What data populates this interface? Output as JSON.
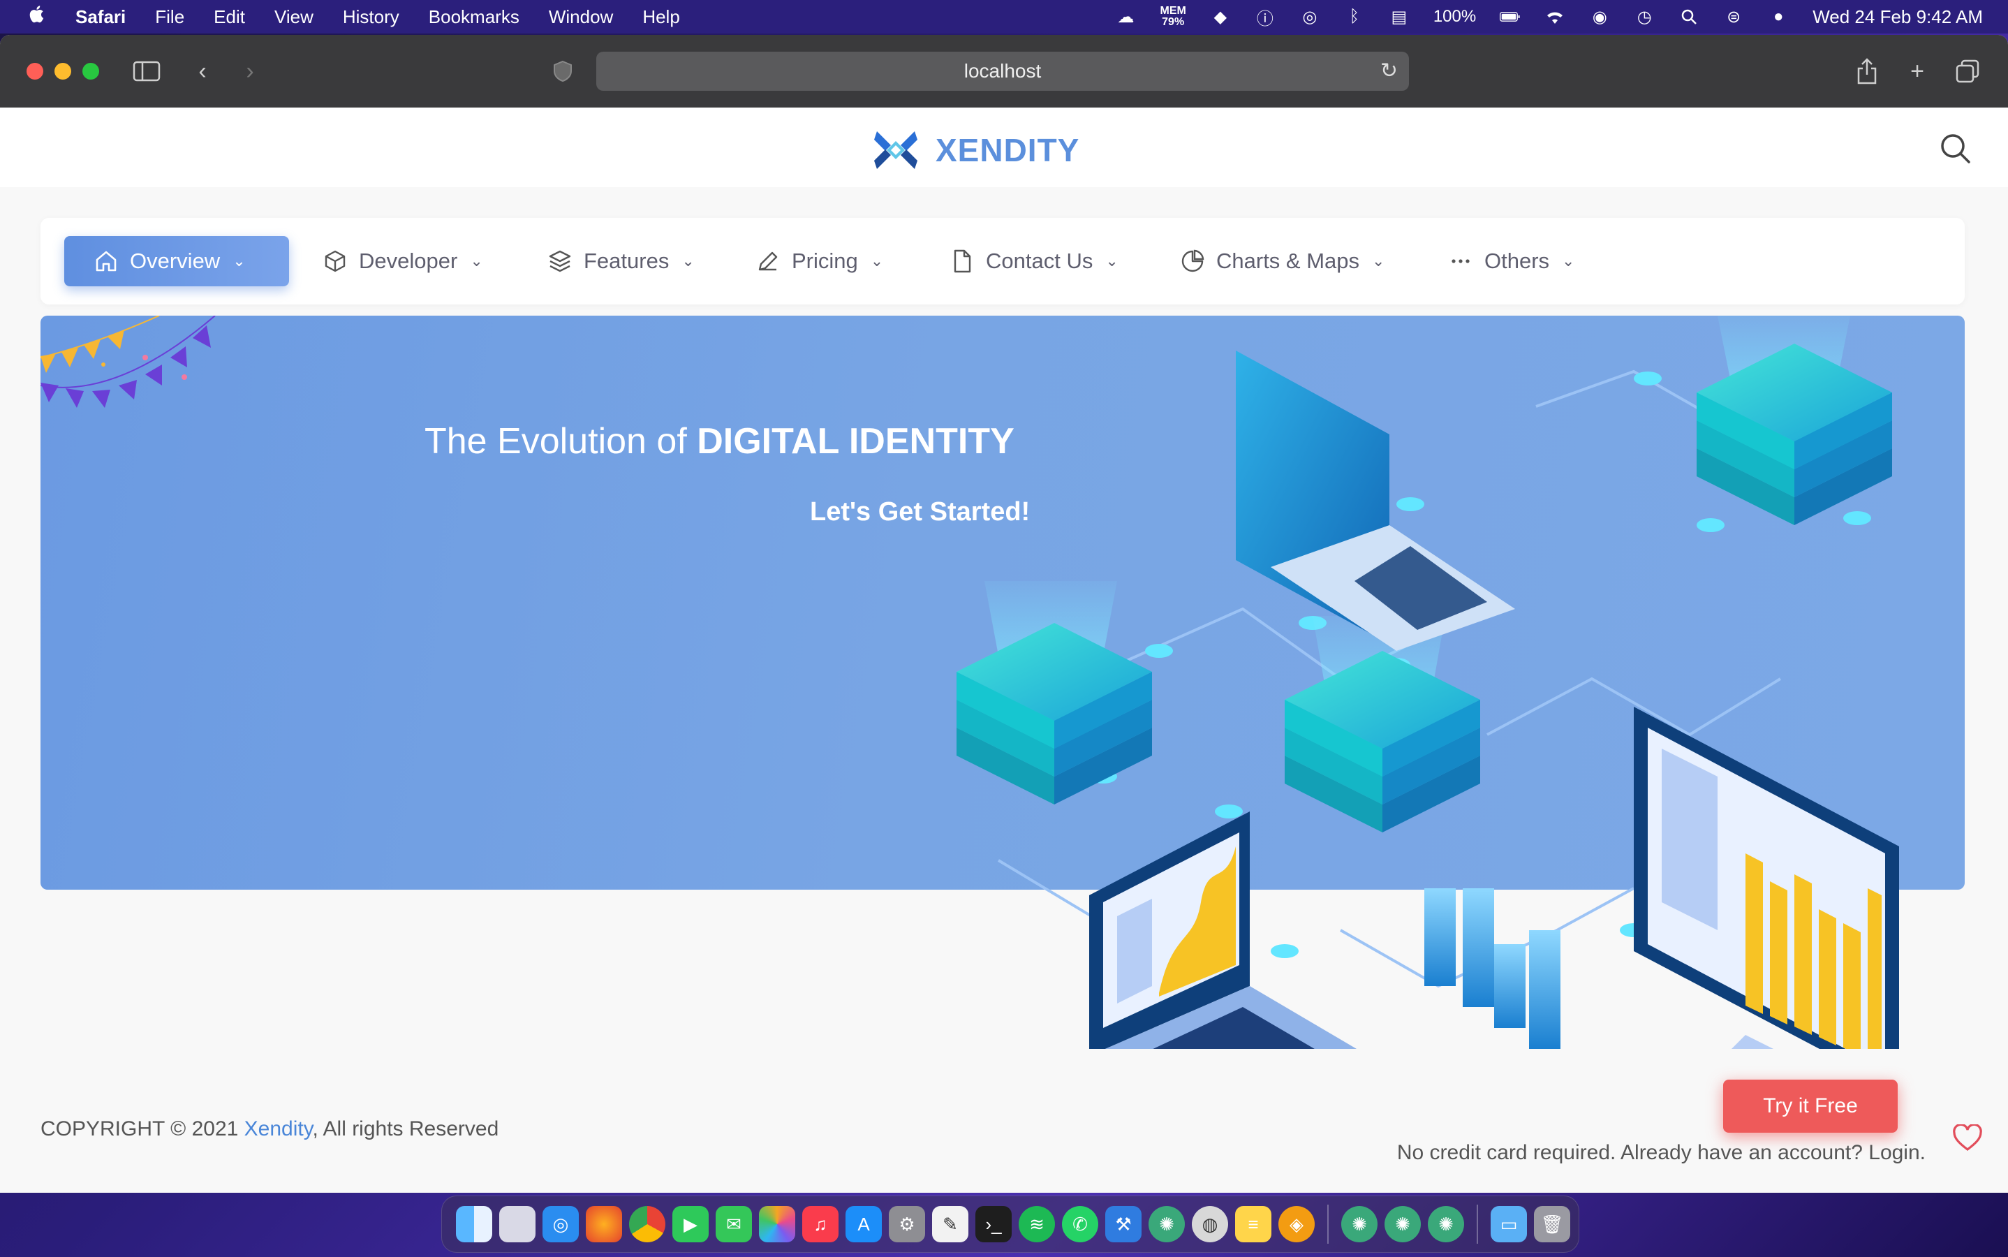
{
  "menubar": {
    "app_name": "Safari",
    "menus": [
      "File",
      "Edit",
      "View",
      "History",
      "Bookmarks",
      "Window",
      "Help"
    ],
    "mem_label": "MEM",
    "mem_value": "79%",
    "battery": "100%",
    "datetime": "Wed 24 Feb  9:42 AM"
  },
  "browser": {
    "url": "localhost"
  },
  "site": {
    "brand": "XENDITY",
    "nav": [
      {
        "label": "Overview",
        "icon": "home-icon",
        "active": true
      },
      {
        "label": "Developer",
        "icon": "box-icon"
      },
      {
        "label": "Features",
        "icon": "layers-icon"
      },
      {
        "label": "Pricing",
        "icon": "pen-icon"
      },
      {
        "label": "Contact Us",
        "icon": "file-icon"
      },
      {
        "label": "Charts & Maps",
        "icon": "pie-chart-icon"
      },
      {
        "label": "Others",
        "icon": "more-horizontal-icon"
      }
    ],
    "hero": {
      "title_prefix": "The Evolution of ",
      "title_strong": "DIGITAL IDENTITY",
      "subtitle": "Let's Get Started!"
    },
    "footer": {
      "copyright_prefix": "COPYRIGHT © 2021 ",
      "copyright_link": "Xendity",
      "copyright_suffix": ", All rights Reserved",
      "cta_label": "Try it Free",
      "note": "No credit card required. Already have an account? Login."
    }
  },
  "colors": {
    "brand": "#5b8fdc",
    "hero_bg": "#78a5e4",
    "cta": "#ee5a5a",
    "menubar": "#2b1f7c"
  }
}
